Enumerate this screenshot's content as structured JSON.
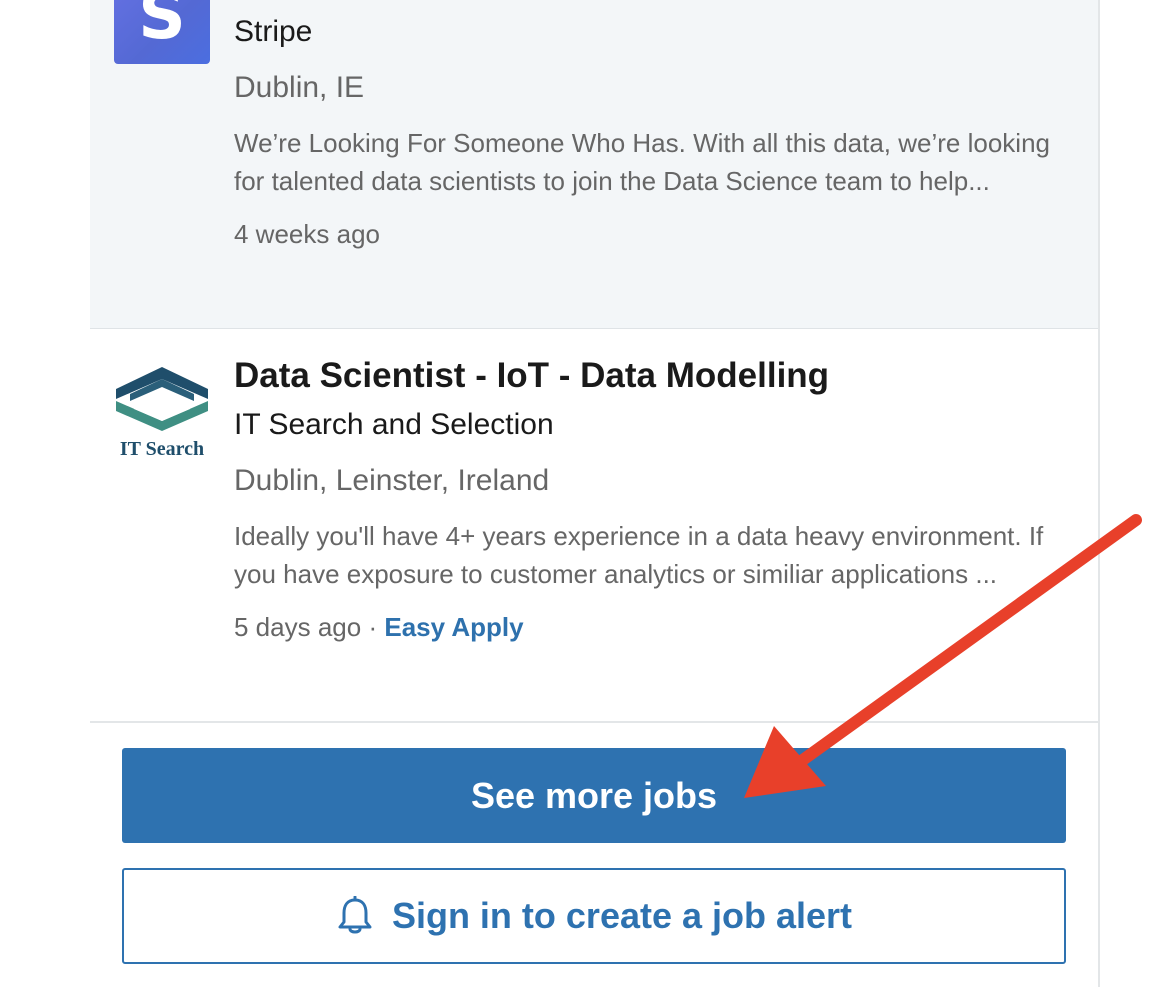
{
  "jobs": [
    {
      "company": "Stripe",
      "location": "Dublin, IE",
      "snippet": "We’re Looking For Someone Who Has. With all this data, we’re looking for talented data scientists to join the Data Science team to help...",
      "posted": "4 weeks ago",
      "logo_letter": "S",
      "logo_icon": "stripe-logo"
    },
    {
      "title": "Data Scientist - IoT - Data Modelling",
      "company": "IT Search and Selection",
      "location": "Dublin, Leinster, Ireland",
      "snippet": "Ideally you'll have 4+ years experience in a data heavy environment. If you have exposure to customer analytics or similiar applications ...",
      "posted": "5 days ago",
      "separator": "·",
      "easy_apply": "Easy Apply",
      "logo_text": "IT Search",
      "logo_icon": "it-search-logo"
    }
  ],
  "actions": {
    "see_more_label": "See more jobs",
    "job_alert_label": "Sign in to create a job alert",
    "job_alert_icon": "bell-icon"
  },
  "colors": {
    "primary": "#2e72b0",
    "highlight_bg": "#f3f6f8",
    "annotation_arrow": "#e8402a"
  }
}
